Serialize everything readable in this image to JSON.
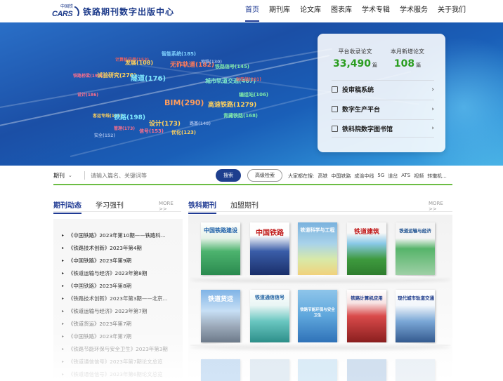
{
  "header": {
    "logo_small": "中国铁",
    "logo_abbr": "CARS",
    "logo_title": "铁路期刊数字出版中心",
    "nav": [
      "首页",
      "期刊库",
      "论文库",
      "图表库",
      "学术专辑",
      "学术服务",
      "关于我们"
    ]
  },
  "hero": {
    "word_cloud": [
      {
        "text": "计算机应用(153)",
        "color": "#e96060"
      },
      {
        "text": "发展(108)",
        "color": "#ffd15c"
      },
      {
        "text": "智能系统(185)",
        "color": "#7fd1ff"
      },
      {
        "text": "无砟轨道(182)",
        "color": "#ff7b59"
      },
      {
        "text": "地铁(130)",
        "color": "#9ab6e6"
      },
      {
        "text": "铁路信号(145)",
        "color": "#7fe8a8"
      },
      {
        "text": "铁路桥梁(190)",
        "color": "#ff6f8a"
      },
      {
        "text": "试验研究(270)",
        "color": "#ffd15c"
      },
      {
        "text": "隧道(176)",
        "color": "#7fe8ff"
      },
      {
        "text": "城市轨道交通(467)",
        "color": "#7fe8c8"
      },
      {
        "text": "动车组(201)",
        "color": "#e96060"
      },
      {
        "text": "设计(186)",
        "color": "#ff6f8a"
      },
      {
        "text": "编组站(106)",
        "color": "#7fe8a8"
      },
      {
        "text": "BIM(290)",
        "color": "#ff9d5c"
      },
      {
        "text": "高速铁路(1279)",
        "color": "#ffd15c"
      },
      {
        "text": "客运专线(195)",
        "color": "#ffd15c"
      },
      {
        "text": "铁路(198)",
        "color": "#7fe8ff"
      },
      {
        "text": "青藏铁路(168)",
        "color": "#7fe8a8"
      },
      {
        "text": "管理(173)",
        "color": "#ff6f8a"
      },
      {
        "text": "设计(173)",
        "color": "#ffd15c"
      },
      {
        "text": "路基(148)",
        "color": "#9ab6e6"
      },
      {
        "text": "安全(152)",
        "color": "#9ab6e6"
      },
      {
        "text": "信号(153)",
        "color": "#ff6f8a"
      },
      {
        "text": "优化(123)",
        "color": "#ffd15c"
      }
    ],
    "stats": [
      {
        "label": "平台收录论文",
        "value": "33,490",
        "unit": "篇"
      },
      {
        "label": "本月新增论文",
        "value": "108",
        "unit": "篇"
      }
    ],
    "links": [
      "投审稿系统",
      "数字生产平台",
      "铁科院数字图书馆"
    ]
  },
  "search": {
    "select_value": "期刊",
    "placeholder": "请输入篇名、关键词等",
    "search_label": "搜索",
    "advanced_label": "高级检索",
    "hot_label": "大家都在搜:",
    "hot_terms": [
      "高铁",
      "中国铁路",
      "成渝中线",
      "5G",
      "道岔",
      "ATS",
      "视频",
      "转辙机..."
    ]
  },
  "left": {
    "tabs": [
      "期刊动态",
      "学习强刊"
    ],
    "more": "MORE >>",
    "news": [
      "《中国铁路》2023年第10期——铁路科...",
      "《铁路技术创新》2023年第4期",
      "《中国铁路》2023年第9期",
      "《铁道运输与经济》2023年第8期",
      "《中国铁路》2023年第8期",
      "《铁路技术创新》2023年第3期——北京...",
      "《铁道运输与经济》2023年第7期",
      "《铁道货运》2023年第7期",
      "《中国铁路》2023年第7期",
      "《铁路节能环保与安全卫生》2023年第3期",
      "《铁道通信信号》2023年第7期论文总览",
      "《铁道通信信号》2023年第6期论文总览"
    ]
  },
  "right": {
    "tabs": [
      "铁科期刊",
      "加盟期刊"
    ],
    "more": "MORE >>",
    "journals_row1": [
      "中国铁路建设",
      "中国铁路",
      "铁道科学与工程",
      "铁道建筑",
      "铁道运输与经济"
    ],
    "journals_row2": [
      "铁道货运",
      "铁道通信信号",
      "铁路节能环保与安全卫生",
      "铁路计算机应用",
      "现代城市轨道交通"
    ]
  },
  "colors": {
    "brand": "#1f3a93",
    "accent_green": "#2a9d1f",
    "search_underline": "#6cbd44"
  }
}
